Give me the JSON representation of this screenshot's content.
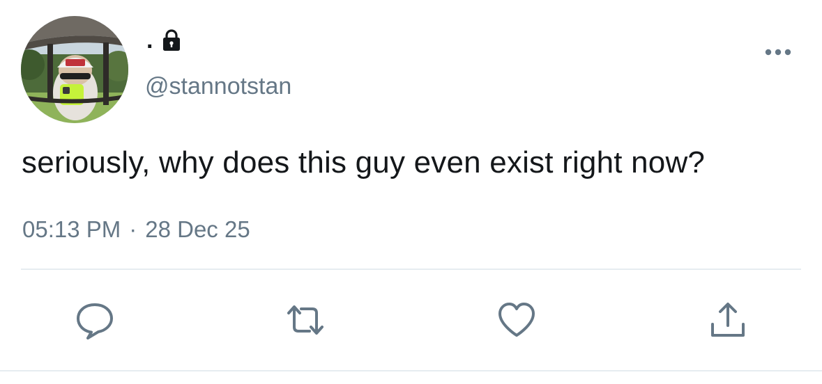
{
  "tweet": {
    "author": {
      "display_name": ".",
      "handle": "@stannotstan",
      "protected_icon": "lock-icon",
      "avatar_icon": "profile-photo"
    },
    "text": "seriously, why does this guy even exist right now?",
    "time": "05:13 PM",
    "separator": "·",
    "date": "28 Dec 25",
    "menu_icon": "more-horizontal-icon"
  },
  "actions": [
    {
      "name": "reply",
      "icon": "speech-bubble-icon"
    },
    {
      "name": "retweet",
      "icon": "retweet-arrows-icon"
    },
    {
      "name": "like",
      "icon": "heart-icon"
    },
    {
      "name": "share",
      "icon": "share-upload-icon"
    }
  ],
  "colors": {
    "text_primary": "#14171a",
    "text_secondary": "#657786",
    "icon": "#657786",
    "divider": "#e6ecf0"
  }
}
